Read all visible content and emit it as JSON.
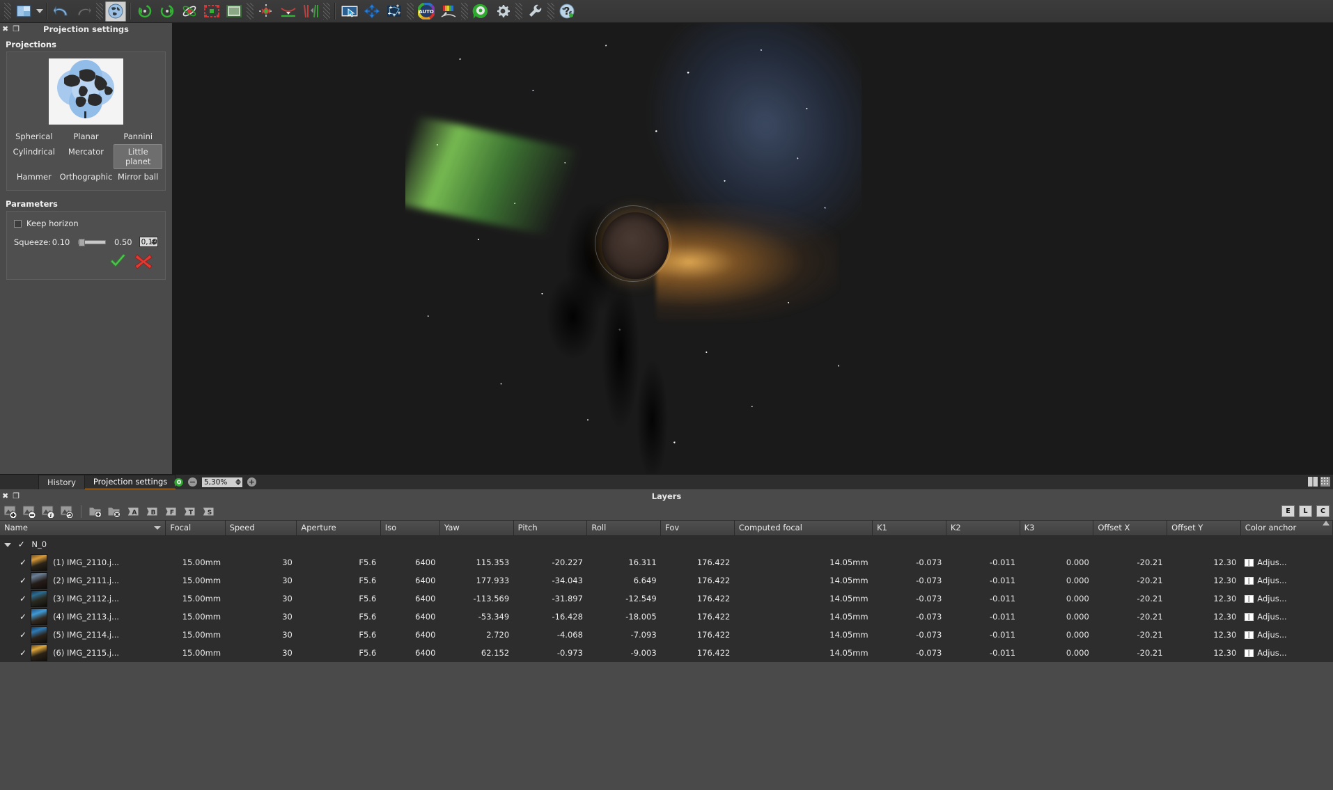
{
  "toolbar": {
    "buttons": [
      {
        "name": "project-open-dropdown",
        "icon": "image-save-icon",
        "label": "Open/Save project"
      },
      {
        "name": "undo-button",
        "icon": "undo-arrow-icon",
        "label": "Undo"
      },
      {
        "name": "redo-button",
        "icon": "redo-arrow-icon",
        "label": "Redo"
      },
      {
        "name": "projection-button",
        "icon": "globe-icon",
        "label": "Projection settings",
        "selected": true
      },
      {
        "name": "rotate-ccw-button",
        "icon": "rotate-ccw-icon",
        "label": "Rotate counter clockwise"
      },
      {
        "name": "rotate-cw-button",
        "icon": "rotate-cw-icon",
        "label": "Rotate clockwise"
      },
      {
        "name": "orientation-button",
        "icon": "atom-orbit-icon",
        "label": "Orientation"
      },
      {
        "name": "crop-button",
        "icon": "crop-marquee-icon",
        "label": "Crop"
      },
      {
        "name": "panel-edit-button",
        "icon": "panel-frame-icon",
        "label": "Panel editor"
      },
      {
        "name": "control-points-button",
        "icon": "control-point-cross-icon",
        "label": "Control points"
      },
      {
        "name": "horizon-button",
        "icon": "horizon-curve-icon",
        "label": "Horizon"
      },
      {
        "name": "vertical-lines-button",
        "icon": "vertical-lines-icon",
        "label": "Vertical lines"
      },
      {
        "name": "select-area-button",
        "icon": "cursor-select-icon",
        "label": "Select area"
      },
      {
        "name": "move-button",
        "icon": "move-arrows-icon",
        "label": "Move"
      },
      {
        "name": "stitch-points-button",
        "icon": "stitch-points-icon",
        "label": "Stitching points"
      },
      {
        "name": "auto-button",
        "icon": "auto-color-wheel-icon",
        "label": "Auto"
      },
      {
        "name": "levels-button",
        "icon": "color-levels-icon",
        "label": "Levels"
      },
      {
        "name": "render-button",
        "icon": "render-gear-green-icon",
        "label": "Render"
      },
      {
        "name": "settings-button",
        "icon": "gear-icon",
        "label": "Settings"
      },
      {
        "name": "tools-button",
        "icon": "wrench-icon",
        "label": "Tools"
      },
      {
        "name": "help-button",
        "icon": "help-globe-icon",
        "label": "Help"
      }
    ]
  },
  "projection_dock": {
    "title": "Projection settings",
    "close_icon": "close-icon",
    "float_icon": "undock-icon",
    "projections_group_label": "Projections",
    "projections": [
      "Spherical",
      "Planar",
      "Pannini",
      "Cylindrical",
      "Mercator",
      "Little planet",
      "Hammer",
      "Orthographic",
      "Mirror ball"
    ],
    "selected_projection": "Little planet",
    "parameters_group_label": "Parameters",
    "keep_horizon_label": "Keep horizon",
    "keep_horizon_checked": false,
    "squeeze_label": "Squeeze:",
    "squeeze_min": "0.10",
    "squeeze_max": "0.50",
    "squeeze_value": "0,10",
    "apply_icon": "green-check-icon",
    "cancel_icon": "red-cross-icon"
  },
  "statusbar": {
    "tabs": [
      {
        "label": "History",
        "active": false
      },
      {
        "label": "Projection settings",
        "active": true
      }
    ],
    "render_icon": "render-gear-green-icon",
    "zoom_out_label": "−",
    "zoom_value": "5,30%",
    "zoom_in_label": "+",
    "layout_icons": [
      "split-view-icon",
      "grid-view-icon"
    ]
  },
  "layers_dock": {
    "title": "Layers",
    "close_icon": "close-icon",
    "float_icon": "undock-icon",
    "toolbar_buttons": [
      {
        "name": "add-image-button",
        "icon": "image-add-icon"
      },
      {
        "name": "remove-image-button",
        "icon": "image-remove-icon"
      },
      {
        "name": "image-info-button",
        "icon": "image-info-icon"
      },
      {
        "name": "reload-image-button",
        "icon": "image-reload-icon"
      },
      {
        "name": "add-group-button",
        "icon": "folder-add-icon"
      },
      {
        "name": "remove-group-button",
        "icon": "folder-remove-icon"
      },
      {
        "name": "group-by-a-button",
        "icon": "folder-a-icon",
        "letter": "A"
      },
      {
        "name": "group-by-b-button",
        "icon": "folder-b-icon",
        "letter": "B"
      },
      {
        "name": "group-by-f-button",
        "icon": "folder-f-icon",
        "letter": "F"
      },
      {
        "name": "group-by-t-button",
        "icon": "folder-t-icon",
        "letter": "T"
      },
      {
        "name": "group-by-s-button",
        "icon": "folder-s-icon",
        "letter": "S"
      }
    ],
    "right_buttons": [
      "E",
      "L",
      "C"
    ],
    "columns": [
      "Name",
      "Focal",
      "Speed",
      "Aperture",
      "Iso",
      "Yaw",
      "Pitch",
      "Roll",
      "Fov",
      "Computed focal",
      "K1",
      "K2",
      "K3",
      "Offset X",
      "Offset Y",
      "Color anchor"
    ],
    "group": {
      "name": "N_0",
      "expanded": true,
      "checked": true
    },
    "rows": [
      {
        "checked": true,
        "name": "(1) IMG_2110.j...",
        "focal": "15.00mm",
        "speed": "30",
        "aperture": "F5.6",
        "iso": "6400",
        "yaw": "115.353",
        "pitch": "-20.227",
        "roll": "16.311",
        "fov": "176.422",
        "computed_focal": "14.05mm",
        "k1": "-0.073",
        "k2": "-0.011",
        "k3": "0.000",
        "offset_x": "-20.21",
        "offset_y": "12.30",
        "color_anchor": "Adjus..."
      },
      {
        "checked": true,
        "name": "(2) IMG_2111.j...",
        "focal": "15.00mm",
        "speed": "30",
        "aperture": "F5.6",
        "iso": "6400",
        "yaw": "177.933",
        "pitch": "-34.043",
        "roll": "6.649",
        "fov": "176.422",
        "computed_focal": "14.05mm",
        "k1": "-0.073",
        "k2": "-0.011",
        "k3": "0.000",
        "offset_x": "-20.21",
        "offset_y": "12.30",
        "color_anchor": "Adjus..."
      },
      {
        "checked": true,
        "name": "(3) IMG_2112.j...",
        "focal": "15.00mm",
        "speed": "30",
        "aperture": "F5.6",
        "iso": "6400",
        "yaw": "-113.569",
        "pitch": "-31.897",
        "roll": "-12.549",
        "fov": "176.422",
        "computed_focal": "14.05mm",
        "k1": "-0.073",
        "k2": "-0.011",
        "k3": "0.000",
        "offset_x": "-20.21",
        "offset_y": "12.30",
        "color_anchor": "Adjus..."
      },
      {
        "checked": true,
        "name": "(4) IMG_2113.j...",
        "focal": "15.00mm",
        "speed": "30",
        "aperture": "F5.6",
        "iso": "6400",
        "yaw": "-53.349",
        "pitch": "-16.428",
        "roll": "-18.005",
        "fov": "176.422",
        "computed_focal": "14.05mm",
        "k1": "-0.073",
        "k2": "-0.011",
        "k3": "0.000",
        "offset_x": "-20.21",
        "offset_y": "12.30",
        "color_anchor": "Adjus..."
      },
      {
        "checked": true,
        "name": "(5) IMG_2114.j...",
        "focal": "15.00mm",
        "speed": "30",
        "aperture": "F5.6",
        "iso": "6400",
        "yaw": "2.720",
        "pitch": "-4.068",
        "roll": "-7.093",
        "fov": "176.422",
        "computed_focal": "14.05mm",
        "k1": "-0.073",
        "k2": "-0.011",
        "k3": "0.000",
        "offset_x": "-20.21",
        "offset_y": "12.30",
        "color_anchor": "Adjus..."
      },
      {
        "checked": true,
        "name": "(6) IMG_2115.j...",
        "focal": "15.00mm",
        "speed": "30",
        "aperture": "F5.6",
        "iso": "6400",
        "yaw": "62.152",
        "pitch": "-0.973",
        "roll": "-9.003",
        "fov": "176.422",
        "computed_focal": "14.05mm",
        "k1": "-0.073",
        "k2": "-0.011",
        "k3": "0.000",
        "offset_x": "-20.21",
        "offset_y": "12.30",
        "color_anchor": "Adjus..."
      }
    ]
  },
  "colors": {
    "toolbar_bg": "#3c3c3c",
    "dock_bg": "#4a4a4a",
    "grid_bg": "#2d2d2d",
    "accent_tab": "#c8863c",
    "selection": "#6e6e6e"
  }
}
